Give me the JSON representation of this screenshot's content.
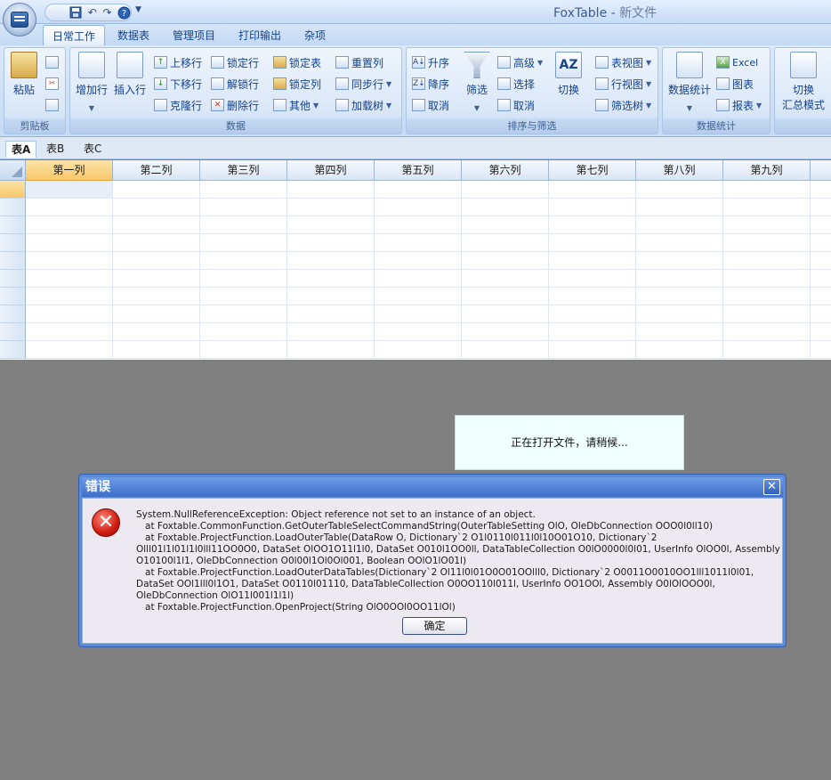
{
  "app": {
    "title_app": "FoxTable",
    "title_sep": " - ",
    "title_doc": "新文件"
  },
  "qat": {
    "save_icon": "save-icon",
    "undo_icon": "undo-icon",
    "redo_icon": "redo-icon",
    "help_icon": "help-icon",
    "dropdown": "▼"
  },
  "ribbon_tabs": [
    "日常工作",
    "数据表",
    "管理项目",
    "打印输出",
    "杂项"
  ],
  "groups": {
    "clipboard": {
      "label": "剪贴板",
      "paste": "粘贴"
    },
    "data": {
      "label": "数据",
      "add_row": "增加行",
      "insert_row": "插入行",
      "move_up": "上移行",
      "move_down": "下移行",
      "clone_row": "克隆行",
      "lock_row": "锁定行",
      "unlock_row": "解锁行",
      "delete_row": "删除行",
      "lock_table": "锁定表",
      "lock_col": "锁定列",
      "other": "其他",
      "reset_col": "重置列",
      "sync_row": "同步行",
      "load_tree": "加载树"
    },
    "sort": {
      "label": "排序与筛选",
      "asc": "升序",
      "desc": "降序",
      "cancel1": "取消",
      "filter": "筛选",
      "advanced": "高级",
      "select": "选择",
      "cancel2": "取消",
      "switch": "切换",
      "table_view": "表视图",
      "row_view": "行视图",
      "filter_tree": "筛选树"
    },
    "stats": {
      "label": "数据统计",
      "stats": "数据统计",
      "excel": "Excel",
      "chart": "图表",
      "report": "报表"
    },
    "summary": {
      "switch": "切换",
      "summary_mode": "汇总模式"
    }
  },
  "sheet_tabs": [
    "表A",
    "表B",
    "表C"
  ],
  "columns": [
    "第一列",
    "第二列",
    "第三列",
    "第四列",
    "第五列",
    "第六列",
    "第七列",
    "第八列",
    "第九列"
  ],
  "progress_message": "正在打开文件，请稍候...",
  "dialog": {
    "title": "错误",
    "close": "✕",
    "error_icon": "error-icon",
    "message": "System.NullReferenceException: Object reference not set to an instance of an object.\n   at Foxtable.CommonFunction.GetOuterTableSelectCommandString(OuterTableSetting OlO, OleDbConnection OOO0l0ll10)\n   at Foxtable.ProjectFunction.LoadOuterTable(DataRow O, Dictionary`2 O1l0110l011l0l10O01O10, Dictionary`2 Olll01l1l01l1l0lll11OO0O0, DataSet OlOO1O11l1l0, DataSet O010l1OO0ll, DataTableCollection O0lO0000l0l01, UserInfo OlOO0l, Assembly O10100l1l1, OleDbConnection O0l00l1Ol0Ol001, Boolean OOlO1lO01l)\n   at Foxtable.ProjectFunction.LoadOuterDataTables(Dictionary`2 Ol11l0l01O0O01OOlll0, Dictionary`2 O0011O0010OO1lll1011l0l01, DataSet OOl1lll0l1O1, DataSet O0110l01110, DataTableCollection O0OO110l011l, UserInfo OO1OOl, Assembly O0lOlOOO0l, OleDbConnection OlO11l001l1l1l)\n   at Foxtable.ProjectFunction.OpenProject(String OlO0OOl0OO11lOl)",
    "ok": "确定"
  }
}
